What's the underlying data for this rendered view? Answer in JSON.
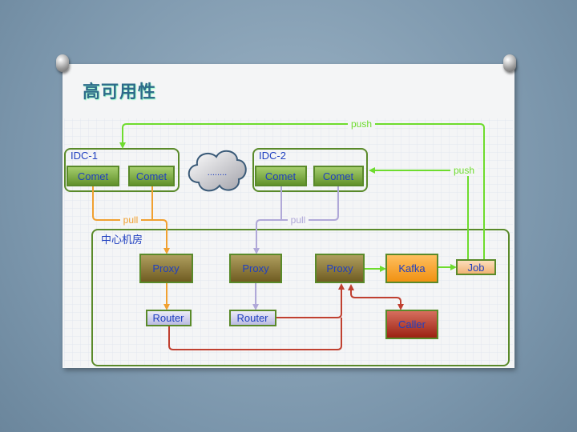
{
  "slide": {
    "title": "高可用性"
  },
  "diagram": {
    "idc1": {
      "label": "IDC-1",
      "nodes": [
        "Comet",
        "Comet"
      ]
    },
    "idc2": {
      "label": "IDC-2",
      "nodes": [
        "Comet",
        "Comet"
      ]
    },
    "cloud": {
      "label": "........"
    },
    "center": {
      "label": "中心机房"
    },
    "proxy1": "Proxy",
    "proxy2": "Proxy",
    "proxy3": "Proxy",
    "router1": "Router",
    "router2": "Router",
    "kafka": "Kafka",
    "job": "Job",
    "caller": "Caller",
    "edges": {
      "pull1": "pull",
      "pull2": "pull",
      "push_top": "push",
      "push_side": "push"
    },
    "colors": {
      "push": "#6edc2e",
      "pull_idc1": "#f0a030",
      "pull_idc2": "#b0a8d8",
      "call": "#c04030",
      "text": "#2040c0",
      "border": "#5a8a2a"
    }
  }
}
